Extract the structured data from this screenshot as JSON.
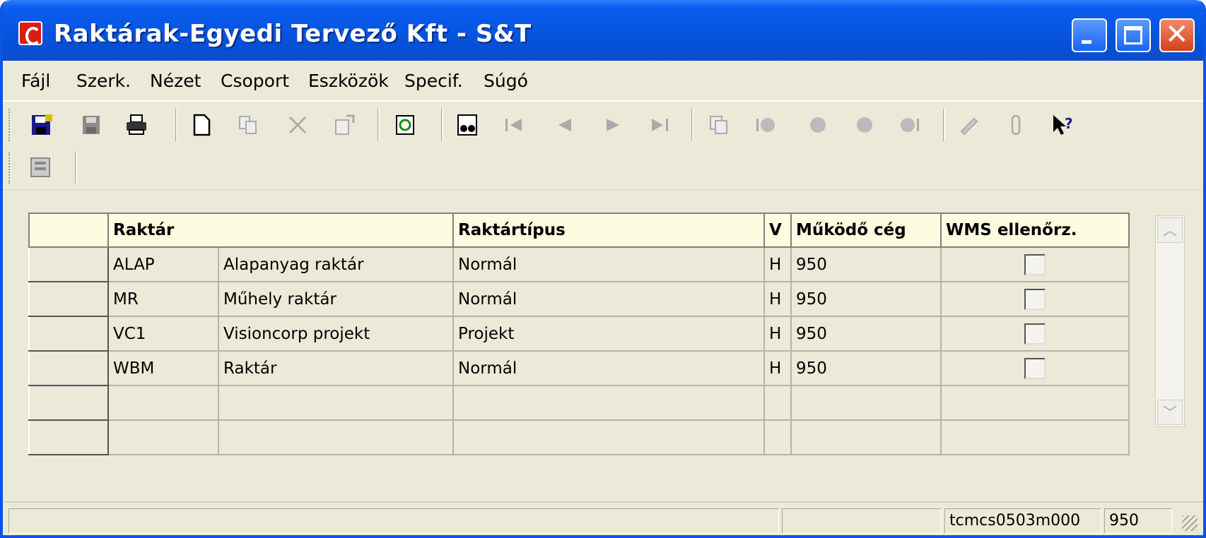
{
  "window": {
    "title": "Raktárak-Egyedi Tervező  Kft - S&T"
  },
  "menu": [
    "Fájl",
    "Szerk.",
    "Nézet",
    "Csoport",
    "Eszközök",
    "Specif.",
    "Súgó"
  ],
  "toolbar": {
    "icons": [
      "save-close-icon",
      "save-icon",
      "print-icon",
      "new-icon",
      "copy-icon",
      "delete-icon",
      "properties-icon",
      "refresh-icon",
      "find-icon",
      "first-record-icon",
      "previous-record-icon",
      "next-record-icon",
      "last-record-icon",
      "group-copy-icon",
      "group-first-icon",
      "group-previous-icon",
      "group-next-icon",
      "group-last-icon",
      "edit-text-icon",
      "attachment-icon",
      "context-help-icon"
    ]
  },
  "toolbar2": {
    "icons": [
      "form-view-icon"
    ]
  },
  "grid": {
    "headers": [
      "Raktár",
      "Raktártípus",
      "V",
      "Működő cég",
      "WMS ellenőrz."
    ],
    "rows": [
      {
        "code": "ALAP",
        "name": "Alapanyag raktár",
        "type": "Normál",
        "v": "H",
        "company": "950",
        "wms": false
      },
      {
        "code": "MR",
        "name": "Műhely raktár",
        "type": "Normál",
        "v": "H",
        "company": "950",
        "wms": false
      },
      {
        "code": "VC1",
        "name": "Visioncorp projekt",
        "type": "Projekt",
        "v": "H",
        "company": "950",
        "wms": false
      },
      {
        "code": "WBM",
        "name": "Raktár",
        "type": "Normál",
        "v": "H",
        "company": "950",
        "wms": false
      }
    ],
    "empty_rows": 2
  },
  "status": {
    "session": "tcmcs0503m000",
    "company": "950"
  },
  "colors": {
    "titlebar": "#0650d8",
    "header_bg": "#fcfce0",
    "window_bg": "#ece9d8"
  }
}
